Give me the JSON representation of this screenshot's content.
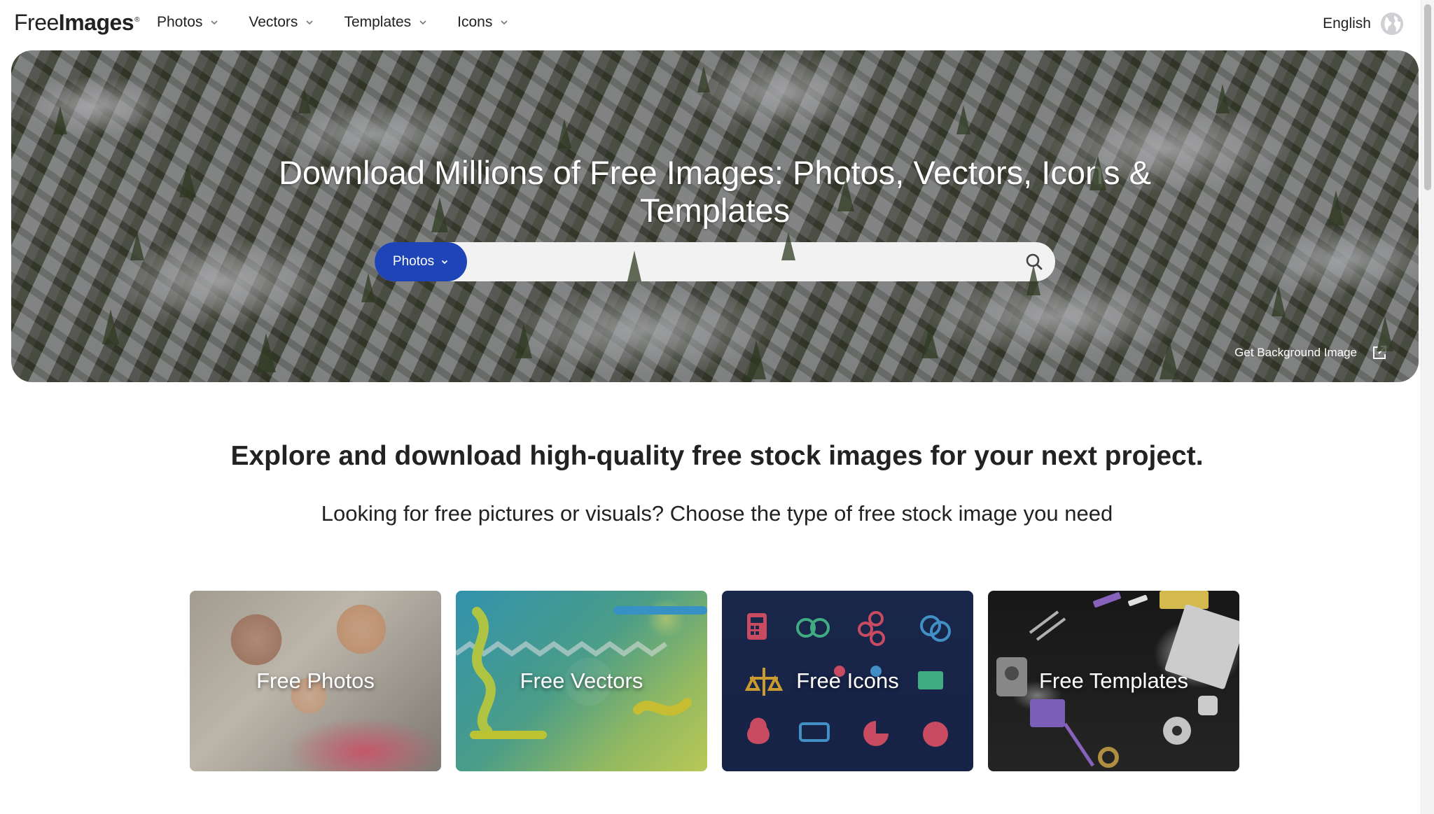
{
  "nav": {
    "logo_light": "Free",
    "logo_bold": "Images",
    "logo_reg": "®",
    "items": [
      {
        "label": "Photos"
      },
      {
        "label": "Vectors"
      },
      {
        "label": "Templates"
      },
      {
        "label": "Icons"
      }
    ],
    "language": "English"
  },
  "hero": {
    "title": "Download Millions of Free Images: Photos, Vectors, Icons & Templates",
    "search_type": "Photos",
    "search_placeholder": "",
    "get_background": "Get Background Image"
  },
  "intro": {
    "explore": "Explore and download high-quality free stock images for your next project.",
    "looking": "Looking for free pictures or visuals? Choose the type of free stock image you need"
  },
  "categories": [
    {
      "label": "Free Photos"
    },
    {
      "label": "Free Vectors"
    },
    {
      "label": "Free Icons"
    },
    {
      "label": "Free Templates"
    }
  ],
  "colors": {
    "search_button": "#1e44b8",
    "icons_card_bg": "#1d2d55"
  }
}
